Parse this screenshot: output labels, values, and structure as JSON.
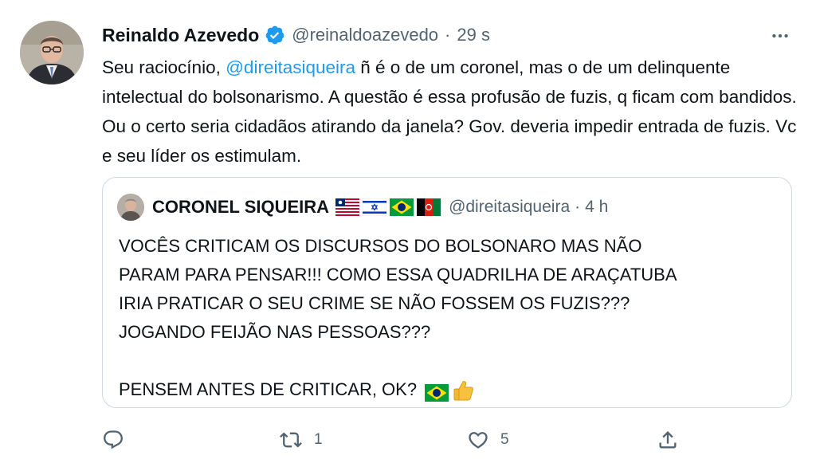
{
  "tweet": {
    "author_name": "Reinaldo Azevedo",
    "author_handle": "@reinaldoazevedo",
    "separator": "·",
    "time": "29 s",
    "text_before": "Seu raciocínio, ",
    "mention": "@direitasiqueira",
    "text_after": " ñ é o de um coronel, mas o de um delinquente intelectual do bolsonarismo. A questão é essa profusão de fuzis, q ficam com bandidos. Ou o certo seria cidadãos atirando da janela? Gov. deveria impedir entrada de fuzis. Vc e seu líder os estimulam."
  },
  "quoted": {
    "author_name": "CORONEL SIQUEIRA",
    "flags": [
      "liberia-flag",
      "israel-flag",
      "brazil-flag",
      "afghanistan-flag"
    ],
    "author_handle": "@direitasiqueira",
    "separator": "·",
    "time": "4 h",
    "lines": [
      "VOCÊS CRITICAM OS DISCURSOS DO BOLSONARO MAS NÃO",
      "PARAM PARA PENSAR!!! COMO ESSA QUADRILHA DE ARAÇATUBA",
      "IRIA PRATICAR O SEU CRIME SE NÃO FOSSEM OS FUZIS???",
      "JOGANDO FEIJÃO NAS PESSOAS???",
      "",
      "PENSEM ANTES DE CRITICAR, OK?"
    ],
    "end_emojis": [
      "brazil-flag",
      "thumbs-up-icon"
    ]
  },
  "actions": {
    "reply_count": "",
    "retweet_count": "1",
    "like_count": "5"
  },
  "colors": {
    "text": "#0f1419",
    "secondary": "#536471",
    "link": "#1d9bf0",
    "border": "#cfd9de"
  },
  "icons": [
    "verified-badge-icon",
    "more-icon",
    "reply-icon",
    "retweet-icon",
    "like-icon",
    "share-icon"
  ]
}
